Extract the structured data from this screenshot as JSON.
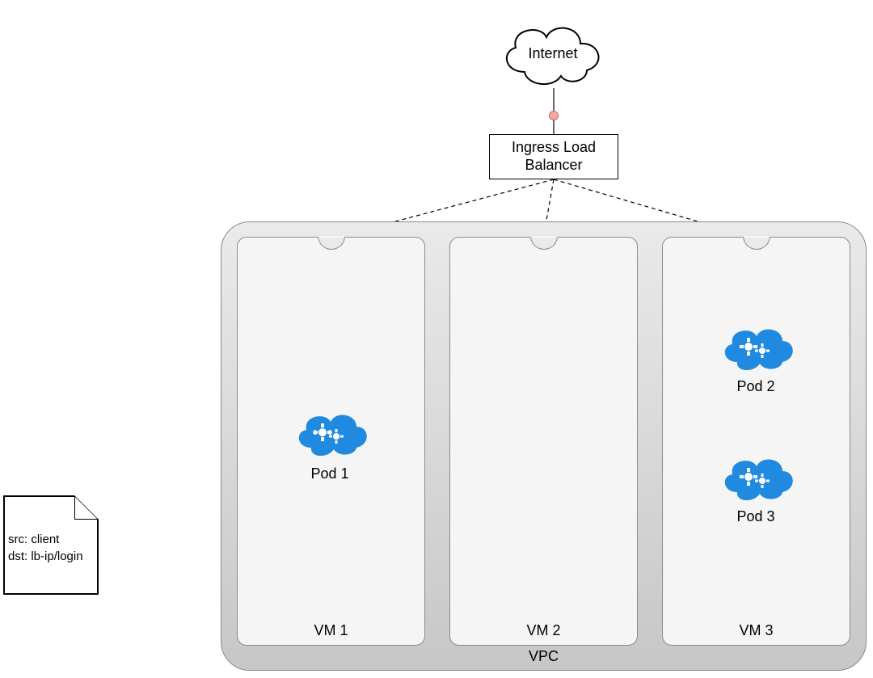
{
  "internet": {
    "label": "Internet"
  },
  "load_balancer": {
    "label": "Ingress Load\nBalancer"
  },
  "vpc": {
    "label": "VPC"
  },
  "vms": [
    {
      "label": "VM 1"
    },
    {
      "label": "VM 2"
    },
    {
      "label": "VM 3"
    }
  ],
  "pods": [
    {
      "label": "Pod 1"
    },
    {
      "label": "Pod 2"
    },
    {
      "label": "Pod 3"
    }
  ],
  "note": {
    "line1": "src: client",
    "line2": "dst: lb-ip/login"
  },
  "colors": {
    "cloud_blue": "#1f8ae0",
    "dot": "#f7a6a0"
  }
}
